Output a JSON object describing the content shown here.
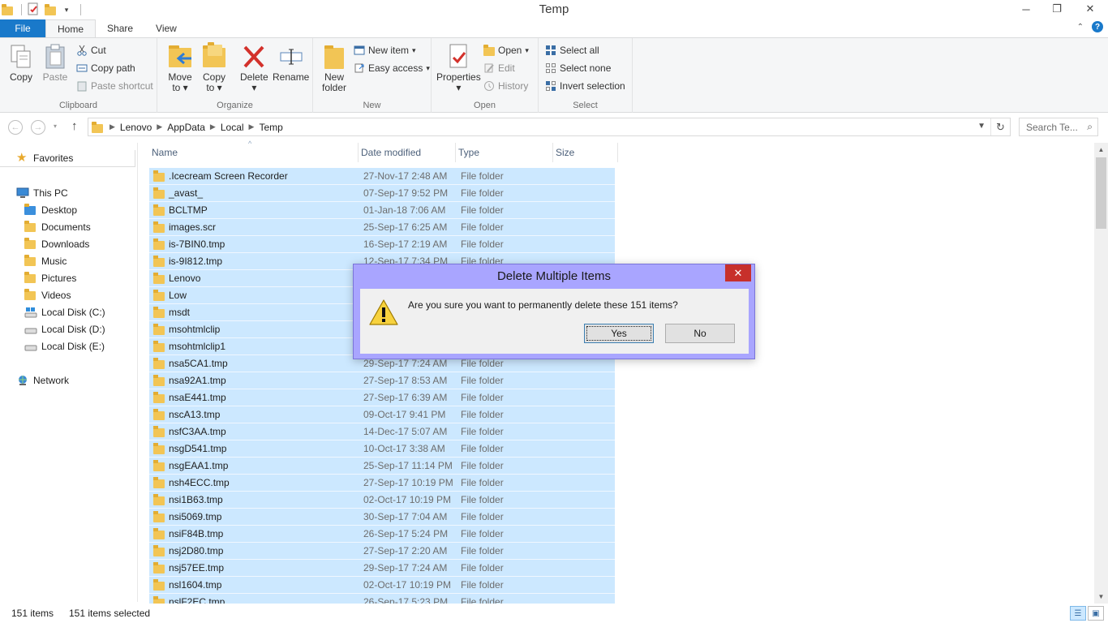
{
  "window": {
    "title": "Temp",
    "minimize": "─",
    "restore": "❐",
    "close": "✕"
  },
  "tabs": [
    "File",
    "Home",
    "Share",
    "View"
  ],
  "ribbon": {
    "clipboard": {
      "label": "Clipboard",
      "copy": "Copy",
      "paste": "Paste",
      "cut": "Cut",
      "copy_path": "Copy path",
      "paste_shortcut": "Paste shortcut"
    },
    "organize": {
      "label": "Organize",
      "move_to_1": "Move",
      "move_to_2": "to",
      "copy_to_1": "Copy",
      "copy_to_2": "to",
      "delete": "Delete",
      "rename": "Rename"
    },
    "new": {
      "label": "New",
      "new_folder_1": "New",
      "new_folder_2": "folder",
      "new_item": "New item",
      "easy_access": "Easy access"
    },
    "open": {
      "label": "Open",
      "properties": "Properties",
      "open": "Open",
      "edit": "Edit",
      "history": "History"
    },
    "select": {
      "label": "Select",
      "select_all": "Select all",
      "select_none": "Select none",
      "invert": "Invert selection"
    }
  },
  "address": {
    "crumbs": [
      "Lenovo",
      "AppData",
      "Local",
      "Temp"
    ],
    "search_placeholder": "Search Te..."
  },
  "nav": {
    "favorites": "Favorites",
    "this_pc": "This PC",
    "desktop": "Desktop",
    "documents": "Documents",
    "downloads": "Downloads",
    "music": "Music",
    "pictures": "Pictures",
    "videos": "Videos",
    "disk_c": "Local Disk (C:)",
    "disk_d": "Local Disk (D:)",
    "disk_e": "Local Disk (E:)",
    "network": "Network"
  },
  "columns": {
    "name": "Name",
    "date": "Date modified",
    "type": "Type",
    "size": "Size"
  },
  "files": [
    {
      "name": ".Icecream Screen Recorder",
      "date": "27-Nov-17 2:48 AM",
      "type": "File folder"
    },
    {
      "name": "_avast_",
      "date": "07-Sep-17 9:52 PM",
      "type": "File folder"
    },
    {
      "name": "BCLTMP",
      "date": "01-Jan-18 7:06 AM",
      "type": "File folder"
    },
    {
      "name": "images.scr",
      "date": "25-Sep-17 6:25 AM",
      "type": "File folder"
    },
    {
      "name": "is-7BIN0.tmp",
      "date": "16-Sep-17 2:19 AM",
      "type": "File folder"
    },
    {
      "name": "is-9I812.tmp",
      "date": "12-Sep-17 7:34 PM",
      "type": "File folder"
    },
    {
      "name": "Lenovo",
      "date": "",
      "type": ""
    },
    {
      "name": "Low",
      "date": "",
      "type": ""
    },
    {
      "name": "msdt",
      "date": "",
      "type": ""
    },
    {
      "name": "msohtmlclip",
      "date": "",
      "type": ""
    },
    {
      "name": "msohtmlclip1",
      "date": "",
      "type": ""
    },
    {
      "name": "nsa5CA1.tmp",
      "date": "29-Sep-17 7:24 AM",
      "type": "File folder"
    },
    {
      "name": "nsa92A1.tmp",
      "date": "27-Sep-17 8:53 AM",
      "type": "File folder"
    },
    {
      "name": "nsaE441.tmp",
      "date": "27-Sep-17 6:39 AM",
      "type": "File folder"
    },
    {
      "name": "nscA13.tmp",
      "date": "09-Oct-17 9:41 PM",
      "type": "File folder"
    },
    {
      "name": "nsfC3AA.tmp",
      "date": "14-Dec-17 5:07 AM",
      "type": "File folder"
    },
    {
      "name": "nsgD541.tmp",
      "date": "10-Oct-17 3:38 AM",
      "type": "File folder"
    },
    {
      "name": "nsgEAA1.tmp",
      "date": "25-Sep-17 11:14 PM",
      "type": "File folder"
    },
    {
      "name": "nsh4ECC.tmp",
      "date": "27-Sep-17 10:19 PM",
      "type": "File folder"
    },
    {
      "name": "nsi1B63.tmp",
      "date": "02-Oct-17 10:19 PM",
      "type": "File folder"
    },
    {
      "name": "nsi5069.tmp",
      "date": "30-Sep-17 7:04 AM",
      "type": "File folder"
    },
    {
      "name": "nsiF84B.tmp",
      "date": "26-Sep-17 5:24 PM",
      "type": "File folder"
    },
    {
      "name": "nsj2D80.tmp",
      "date": "27-Sep-17 2:20 AM",
      "type": "File folder"
    },
    {
      "name": "nsj57EE.tmp",
      "date": "29-Sep-17 7:24 AM",
      "type": "File folder"
    },
    {
      "name": "nsl1604.tmp",
      "date": "02-Oct-17 10:19 PM",
      "type": "File folder"
    },
    {
      "name": "nslF2EC.tmp",
      "date": "26-Sep-17 5:23 PM",
      "type": "File folder"
    }
  ],
  "status": {
    "count": "151 items",
    "selected": "151 items selected"
  },
  "dialog": {
    "title": "Delete Multiple Items",
    "close": "✕",
    "message": "Are you sure you want to permanently delete these 151 items?",
    "yes": "Yes",
    "no": "No"
  },
  "colors": {
    "accent": "#1979ca",
    "selection": "#cce8ff",
    "dialog_frame": "#a9a5ff",
    "close_red": "#c7302b"
  }
}
